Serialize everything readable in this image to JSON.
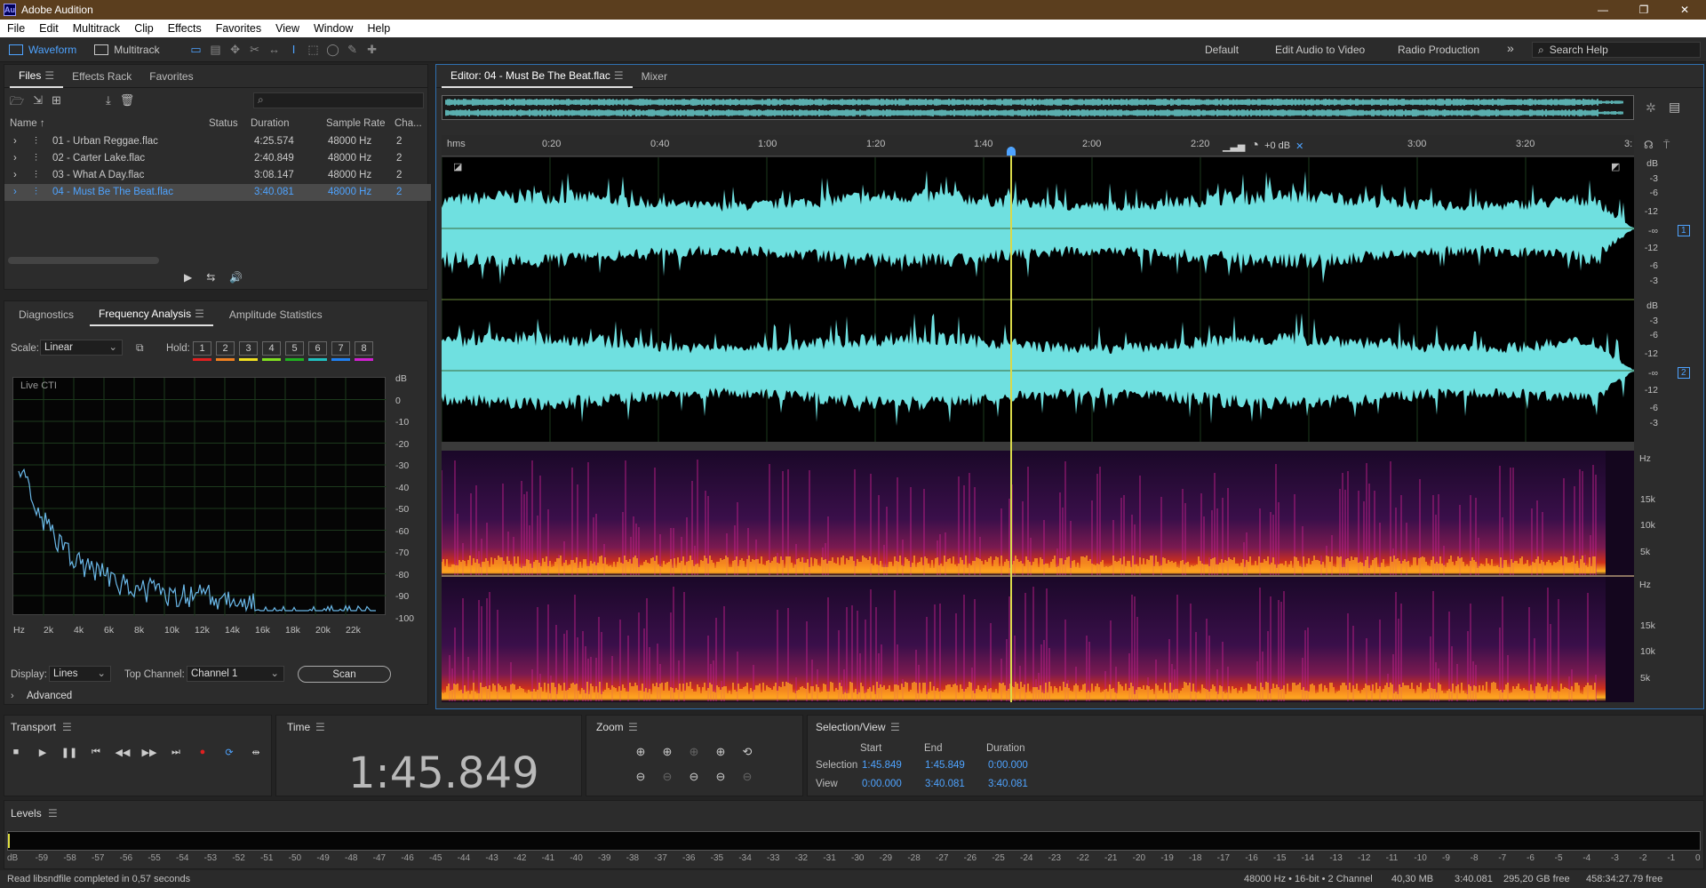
{
  "app": {
    "title": "Adobe Audition",
    "logo": "Au"
  },
  "menu": [
    "File",
    "Edit",
    "Multitrack",
    "Clip",
    "Effects",
    "Favorites",
    "View",
    "Window",
    "Help"
  ],
  "toolbar": {
    "waveform": "Waveform",
    "multitrack": "Multitrack"
  },
  "workspaces": {
    "default": "Default",
    "edit_to_video": "Edit Audio to Video",
    "radio": "Radio Production",
    "more": "»",
    "search_placeholder": "Search Help"
  },
  "files_panel": {
    "tabs": [
      "Files",
      "Effects Rack",
      "Favorites"
    ],
    "columns": {
      "name": "Name ↑",
      "status": "Status",
      "duration": "Duration",
      "sample_rate": "Sample Rate",
      "channels": "Cha..."
    },
    "rows": [
      {
        "name": "01 - Urban Reggae.flac",
        "duration": "4:25.574",
        "rate": "48000 Hz",
        "ch": "2"
      },
      {
        "name": "02 - Carter Lake.flac",
        "duration": "2:40.849",
        "rate": "48000 Hz",
        "ch": "2"
      },
      {
        "name": "03 - What A Day.flac",
        "duration": "3:08.147",
        "rate": "48000 Hz",
        "ch": "2"
      },
      {
        "name": "04 - Must Be The Beat.flac",
        "duration": "3:40.081",
        "rate": "48000 Hz",
        "ch": "2"
      }
    ],
    "selected_index": 3
  },
  "analysis_panel": {
    "tabs": [
      "Diagnostics",
      "Frequency Analysis",
      "Amplitude Statistics"
    ],
    "scale_label": "Scale:",
    "scale_value": "Linear",
    "hold_label": "Hold:",
    "holds": [
      "1",
      "2",
      "3",
      "4",
      "5",
      "6",
      "7",
      "8"
    ],
    "hold_colors": [
      "#e02020",
      "#f08020",
      "#f0e020",
      "#80e020",
      "#20b020",
      "#20c0c0",
      "#2080f0",
      "#d020d0"
    ],
    "graph_label": "Live CTI",
    "db_ticks": [
      "dB",
      "0",
      "-10",
      "-20",
      "-30",
      "-40",
      "-50",
      "-60",
      "-70",
      "-80",
      "-90",
      "-100"
    ],
    "hz_ticks": [
      "Hz",
      "2k",
      "4k",
      "6k",
      "8k",
      "10k",
      "12k",
      "14k",
      "16k",
      "18k",
      "20k",
      "22k"
    ],
    "display_label": "Display:",
    "display_value": "Lines",
    "top_channel_label": "Top Channel:",
    "top_channel_value": "Channel 1",
    "scan": "Scan",
    "advanced": "Advanced"
  },
  "editor": {
    "tab": "Editor: 04 - Must Be The Beat.flac",
    "mixer": "Mixer",
    "ruler": [
      "hms",
      "0:20",
      "0:40",
      "1:00",
      "1:20",
      "1:40",
      "2:00",
      "2:20",
      "3:00",
      "3:20",
      "3:"
    ],
    "gain": "+0 dB",
    "db_scale": [
      "dB",
      "-3",
      "-6",
      "-12",
      "-∞",
      "-12",
      "-6",
      "-3"
    ],
    "channel_badges": [
      "1",
      "2"
    ],
    "hz_scale": [
      "Hz",
      "15k",
      "10k",
      "5k"
    ],
    "waveform_color": "#6fe0e0",
    "playhead_fraction": 0.477
  },
  "transport": {
    "title": "Transport"
  },
  "time": {
    "title": "Time",
    "value": "1:45.849"
  },
  "zoom": {
    "title": "Zoom"
  },
  "selection_view": {
    "title": "Selection/View",
    "headers": [
      "Start",
      "End",
      "Duration"
    ],
    "selection_label": "Selection",
    "selection": [
      "1:45.849",
      "1:45.849",
      "0:00.000"
    ],
    "view_label": "View",
    "view": [
      "0:00.000",
      "3:40.081",
      "3:40.081"
    ]
  },
  "levels": {
    "title": "Levels",
    "ticks": [
      "dB",
      "-59",
      "-58",
      "-57",
      "-56",
      "-55",
      "-54",
      "-53",
      "-52",
      "-51",
      "-50",
      "-49",
      "-48",
      "-47",
      "-46",
      "-45",
      "-44",
      "-43",
      "-42",
      "-41",
      "-40",
      "-39",
      "-38",
      "-37",
      "-36",
      "-35",
      "-34",
      "-33",
      "-32",
      "-31",
      "-30",
      "-29",
      "-28",
      "-27",
      "-26",
      "-25",
      "-24",
      "-23",
      "-22",
      "-21",
      "-20",
      "-19",
      "-18",
      "-17",
      "-16",
      "-15",
      "-14",
      "-13",
      "-12",
      "-11",
      "-10",
      "-9",
      "-8",
      "-7",
      "-6",
      "-5",
      "-4",
      "-3",
      "-2",
      "-1",
      "0"
    ]
  },
  "status": {
    "message": "Read libsndfile completed in 0,57 seconds",
    "format": "48000 Hz • 16-bit • 2 Channel",
    "size": "40,30 MB",
    "duration": "3:40.081",
    "free": "295,20 GB free",
    "free_time": "458:34:27.79 free"
  }
}
